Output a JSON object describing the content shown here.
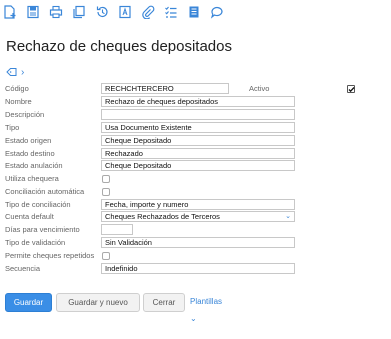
{
  "toolbar": {
    "icons": [
      "new-document-icon",
      "save-icon",
      "print-icon",
      "copy-icon",
      "history-icon",
      "text-icon",
      "attachment-icon",
      "checklist-icon",
      "notes-icon",
      "comment-icon"
    ]
  },
  "page": {
    "title": "Rechazo de cheques depositados"
  },
  "form": {
    "codigo": {
      "label": "Código",
      "value": "RECHCHTERCERO"
    },
    "activo": {
      "label": "Activo",
      "checked": true
    },
    "nombre": {
      "label": "Nombre",
      "value": "Rechazo de cheques depositados"
    },
    "descripcion": {
      "label": "Descripción",
      "value": ""
    },
    "tipo": {
      "label": "Tipo",
      "value": "Usa Documento Existente"
    },
    "estado_origen": {
      "label": "Estado origen",
      "value": "Cheque Depositado"
    },
    "estado_destino": {
      "label": "Estado destino",
      "value": "Rechazado"
    },
    "estado_anulacion": {
      "label": "Estado anulación",
      "value": "Cheque Depositado"
    },
    "utiliza_chequera": {
      "label": "Utiliza chequera",
      "checked": false
    },
    "conciliacion_automatica": {
      "label": "Conciliación automática",
      "checked": false
    },
    "tipo_conciliacion": {
      "label": "Tipo de conciliación",
      "value": "Fecha, importe y numero"
    },
    "cuenta_default": {
      "label": "Cuenta default",
      "value": "Cheques Rechazados de Terceros"
    },
    "dias_vencimiento": {
      "label": "Días para vencimiento",
      "value": ""
    },
    "tipo_validacion": {
      "label": "Tipo de validación",
      "value": "Sin Validación"
    },
    "permite_repetidos": {
      "label": "Permite cheques repetidos",
      "checked": false
    },
    "secuencia": {
      "label": "Secuencia",
      "value": "Indefinido"
    }
  },
  "buttons": {
    "guardar": "Guardar",
    "guardar_nuevo": "Guardar y nuevo",
    "cerrar": "Cerrar",
    "plantillas": "Plantillas"
  },
  "colors": {
    "accent": "#3a86d8",
    "primary_button": "#3a8ee6"
  }
}
